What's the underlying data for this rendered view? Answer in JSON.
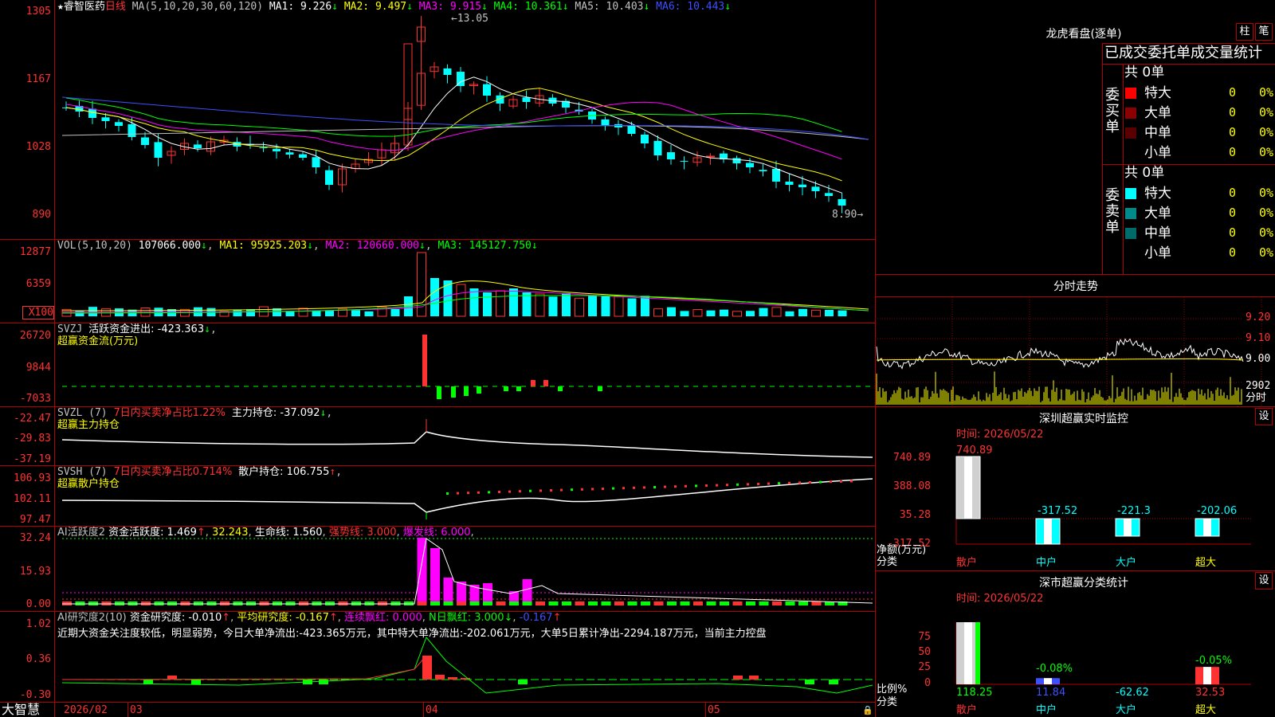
{
  "stock": {
    "name": "睿智医药",
    "star": "★",
    "period": "日线"
  },
  "kline": {
    "ma_header": "MA(5,10,20,30,60,120)",
    "ma_values": [
      {
        "label": "MA1: 9.226",
        "arrow": "↓",
        "color": "#ffffff"
      },
      {
        "label": "MA2: 9.497",
        "arrow": "↓",
        "color": "#ffff00"
      },
      {
        "label": "MA3: 9.915",
        "arrow": "↓",
        "color": "#ff00ff"
      },
      {
        "label": "MA4: 10.361",
        "arrow": "↓",
        "color": "#00ff00"
      },
      {
        "label": "MA5: 10.403",
        "arrow": "↓",
        "color": "#c0c0c0"
      },
      {
        "label": "MA6: 10.443",
        "arrow": "↓",
        "color": "#3c50ff"
      }
    ],
    "axis": [
      "1305",
      "1167",
      "1028",
      "890"
    ],
    "high_label": "13.05",
    "low_label": "8.90"
  },
  "vol": {
    "header": "VOL(5,10,20)",
    "value": "107066.000",
    "ma1": "MA1: 95925.203",
    "ma2": "MA2: 120660.000",
    "ma3": "MA3: 145127.750",
    "axis": [
      "12877",
      "6359",
      "X100"
    ]
  },
  "svzj": {
    "header": "SVZJ",
    "label": "活跃资金进出: -423.363",
    "sub": "超赢资金流(万元)",
    "axis": [
      "26720",
      "9844",
      "-7033"
    ]
  },
  "svzl": {
    "header": "SVZL (7)",
    "ratio": "7日内买卖净占比1.22%",
    "label": "主力持仓: -37.092",
    "sub": "超赢主力持仓",
    "axis": [
      "-22.47",
      "-29.83",
      "-37.19"
    ]
  },
  "svsh": {
    "header": "SVSH (7)",
    "ratio": "7日内买卖净占比0.714%",
    "label": "散户持仓: 106.755",
    "sub": "超赢散户持仓",
    "axis": [
      "106.93",
      "102.11",
      "97.47"
    ]
  },
  "ai_act": {
    "header": "AI活跃度2",
    "l1": "资金活跃度: 1.469",
    "l2": "32.243",
    "l3": "生命线: 1.560",
    "l4": "强势线: 3.000",
    "l5": "爆发线: 6.000",
    "axis": [
      "32.24",
      "15.93",
      "0.00"
    ]
  },
  "ai_res": {
    "header": "AI研究度2(10)",
    "l1": "资金研究度: -0.010",
    "l2": "平均研究度: -0.167",
    "l3": "连续飘红: 0.000",
    "l4": "N日飘红: 3.000",
    "l5": "-0.167",
    "comment": "近期大资金关注度较低，明显弱势，今日大单净流出:-423.365万元，其中特大单净流出:-202.061万元，大单5日累计净出-2294.187万元，当前主力控盘",
    "axis": [
      "1.02",
      "0.36",
      "-0.30"
    ]
  },
  "dates": {
    "brand": "大智慧",
    "labels": [
      "2026/02",
      "03",
      "04",
      "05"
    ]
  },
  "lhb": {
    "title": "龙虎看盘(逐单)",
    "btn1": "柱",
    "btn2": "笔",
    "subtitle": "已成交委托单成交量统计",
    "buy_label": "委买单",
    "sell_label": "委卖单",
    "buy_total": "共 0单",
    "sell_total": "共 0单",
    "buy_rows": [
      {
        "name": "特大",
        "count": "0",
        "pct": "0%",
        "color": "#ff0000"
      },
      {
        "name": "大单",
        "count": "0",
        "pct": "0%",
        "color": "#8b0000"
      },
      {
        "name": "中单",
        "count": "0",
        "pct": "0%",
        "color": "#5a0000"
      },
      {
        "name": "小单",
        "count": "0",
        "pct": "0%",
        "color": ""
      }
    ],
    "sell_rows": [
      {
        "name": "特大",
        "count": "0",
        "pct": "0%",
        "color": "#00ffff"
      },
      {
        "name": "大单",
        "count": "0",
        "pct": "0%",
        "color": "#008b8b"
      },
      {
        "name": "中单",
        "count": "0",
        "pct": "0%",
        "color": "#006b6b"
      },
      {
        "name": "小单",
        "count": "0",
        "pct": "0%",
        "color": ""
      }
    ]
  },
  "fenshi": {
    "title": "分时走势",
    "axis": [
      "9.20",
      "9.10",
      "9.00"
    ],
    "vol_label": "2902",
    "vol_unit": "分时"
  },
  "monitor": {
    "title": "深圳超赢实时监控",
    "btn": "设",
    "time": "时间: 2026/05/22",
    "axis": [
      "740.89",
      "388.08",
      "35.28",
      "-317.52"
    ],
    "ylabel1": "净额(万元)",
    "ylabel2": "分类",
    "bars": [
      {
        "cat": "散户",
        "value": 740.89,
        "label": "740.89"
      },
      {
        "cat": "中户",
        "value": -317.52,
        "label": "-317.52"
      },
      {
        "cat": "大户",
        "value": -221.3,
        "label": "-221.3"
      },
      {
        "cat": "超大",
        "value": -202.06,
        "label": "-202.06"
      }
    ]
  },
  "classify": {
    "title": "深市超赢分类统计",
    "btn": "设",
    "time": "时间: 2026/05/22",
    "axis": [
      "75",
      "50",
      "25",
      "0"
    ],
    "ylabel1": "比例%",
    "ylabel2": "分类",
    "bars": [
      {
        "cat": "散户",
        "value": "118.25",
        "pct_label": "",
        "pct": 100
      },
      {
        "cat": "中户",
        "value": "11.84",
        "pct_label": "-0.08%",
        "pct": 10
      },
      {
        "cat": "大户",
        "value": "-62.62",
        "pct_label": "",
        "pct": 0
      },
      {
        "cat": "超大",
        "value": "32.53",
        "pct_label": "-0.05%",
        "pct": 28
      }
    ]
  }
}
